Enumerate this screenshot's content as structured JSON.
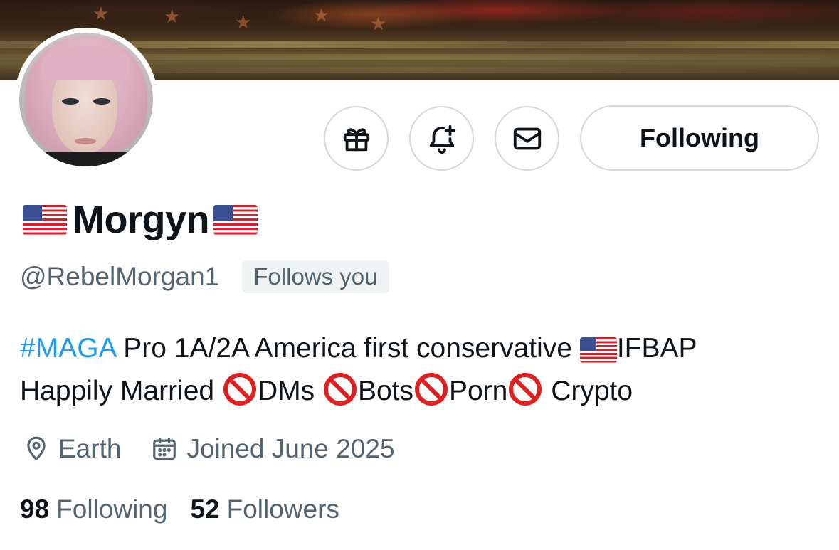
{
  "profile": {
    "display_name": "Morgyn",
    "handle": "@RebelMorgan1",
    "follows_you_badge": "Follows you",
    "bio": {
      "hashtag": "#MAGA",
      "line1_text": " Pro 1A/2A America first conservative ",
      "line1_end": "IFBAP",
      "line2_start": "Happily Married ",
      "dms": "DMs ",
      "bots": "Bots",
      "porn": "Porn",
      "crypto": " Crypto"
    },
    "location": "Earth",
    "joined": "Joined June 2025",
    "following_count": "98",
    "following_label": "Following",
    "followers_count": "52",
    "followers_label": "Followers"
  },
  "actions": {
    "gift_icon": "gift-icon",
    "notify_icon": "bell-plus-icon",
    "message_icon": "envelope-icon",
    "follow_state_label": "Following"
  },
  "colors": {
    "link": "#1d9bf0",
    "secondary_text": "#536471",
    "primary_text": "#0f1419",
    "border": "#cfd9de"
  }
}
